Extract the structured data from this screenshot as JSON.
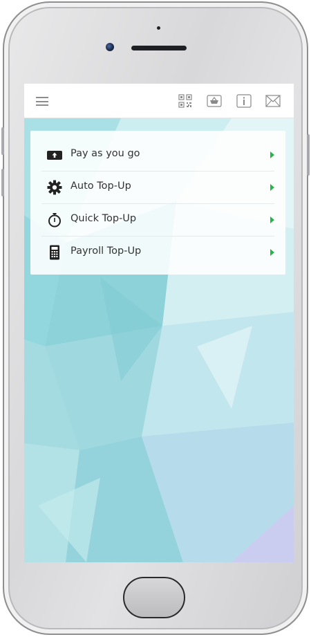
{
  "device": {
    "frame_color": "#d8d8da",
    "speaker_icon": "speaker-slot",
    "camera_icon": "front-camera",
    "home_button_icon": "home-button"
  },
  "header": {
    "menu_icon": "hamburger-icon",
    "icons": [
      {
        "name": "qr-code-icon"
      },
      {
        "name": "basket-icon"
      },
      {
        "name": "info-icon"
      },
      {
        "name": "mail-icon"
      }
    ],
    "background": "#ffffff"
  },
  "menu": {
    "items": [
      {
        "label": "Pay as you go",
        "icon": "wallet-icon"
      },
      {
        "label": "Auto Top-Up",
        "icon": "gear-icon"
      },
      {
        "label": "Quick Top-Up",
        "icon": "stopwatch-icon"
      },
      {
        "label": "Payroll Top-Up",
        "icon": "calculator-icon"
      }
    ],
    "arrow_color": "#27b44a",
    "arrow_icon": "triangle-right-icon"
  },
  "background": {
    "colors": [
      "#b9e6ea",
      "#8fd6db",
      "#d9f1f3",
      "#c9d8f0"
    ]
  }
}
